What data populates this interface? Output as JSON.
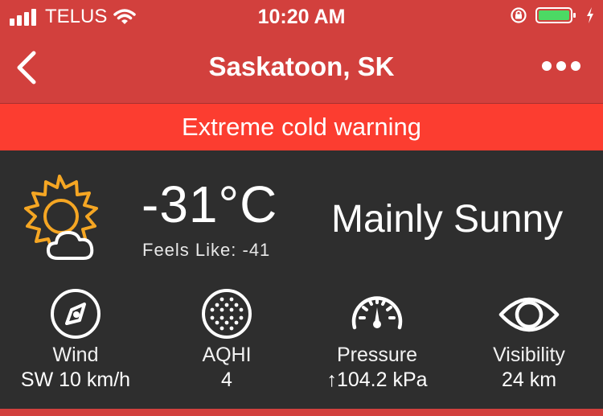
{
  "status_bar": {
    "carrier": "TELUS",
    "time": "10:20 AM",
    "battery_color": "#4cd964"
  },
  "nav": {
    "title": "Saskatoon, SK"
  },
  "warning": {
    "text": "Extreme cold warning",
    "color": "#fc3d30"
  },
  "current": {
    "icon": "sun-cloud-icon",
    "temperature": "-31°C",
    "feels_like": "Feels Like: -41",
    "condition": "Mainly Sunny"
  },
  "metrics": [
    {
      "icon": "compass-icon",
      "label": "Wind",
      "value": "SW 10 km/h"
    },
    {
      "icon": "aqhi-dots-icon",
      "label": "AQHI",
      "value": "4"
    },
    {
      "icon": "pressure-gauge-icon",
      "label": "Pressure",
      "value": "↑104.2 kPa"
    },
    {
      "icon": "eye-icon",
      "label": "Visibility",
      "value": "24 km"
    }
  ],
  "colors": {
    "header_red": "#d2403d",
    "background": "#2e2e2e",
    "sun_orange": "#f5a623"
  }
}
